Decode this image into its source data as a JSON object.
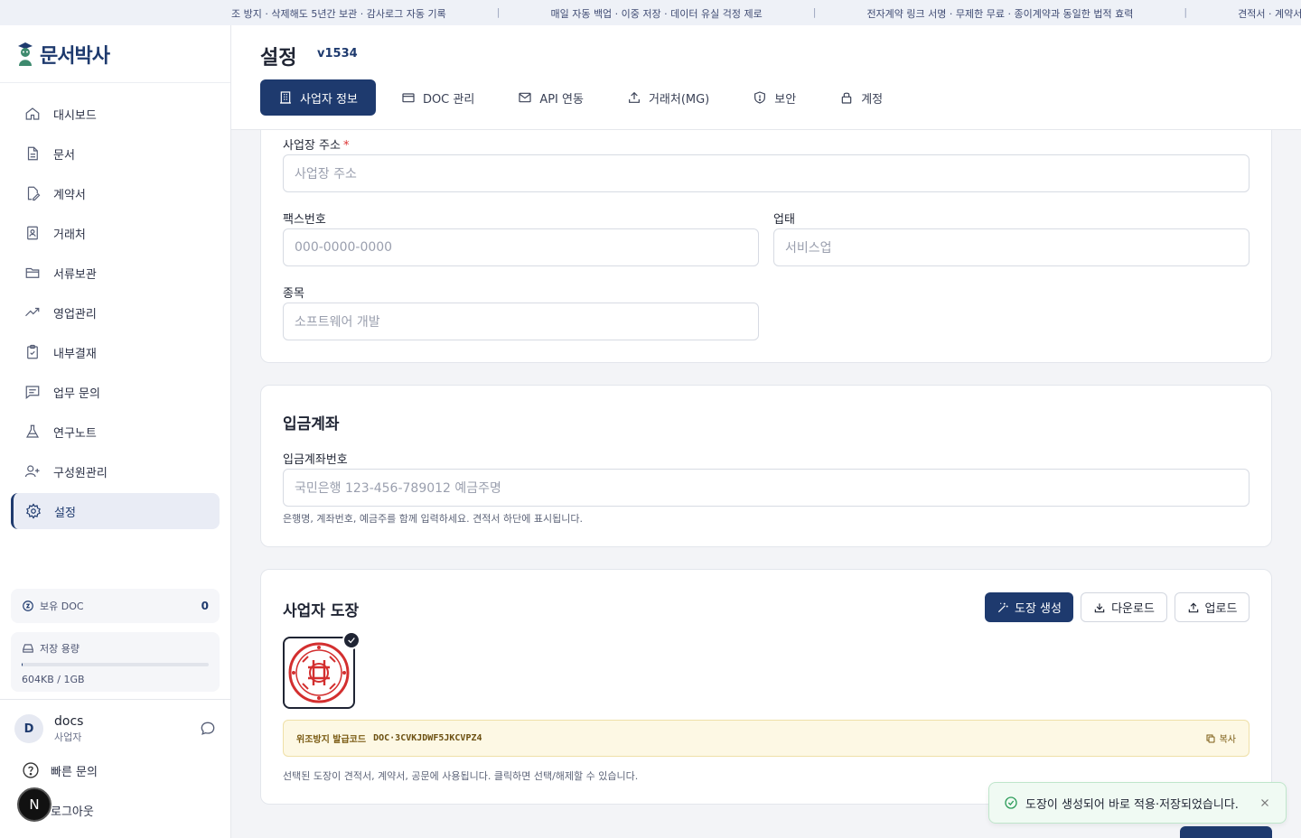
{
  "ticker": [
    "조 방지 · 삭제해도 5년간 보관 · 감사로그 자동 기록",
    "매일 자동 백업 · 이중 저장 · 데이터 유실 걱정 제로",
    "전자계약 링크 서명 · 무제한 무료 · 종이계약과 동일한 법적 효력",
    "견적서 · 계약서"
  ],
  "brand": {
    "name": "문서박사"
  },
  "sidebar": {
    "items": [
      {
        "label": "대시보드",
        "icon": "home-icon"
      },
      {
        "label": "문서",
        "icon": "document-icon"
      },
      {
        "label": "계약서",
        "icon": "contract-icon"
      },
      {
        "label": "거래처",
        "icon": "contact-icon"
      },
      {
        "label": "서류보관",
        "icon": "folder-icon"
      },
      {
        "label": "영업관리",
        "icon": "trend-icon"
      },
      {
        "label": "내부결재",
        "icon": "clipboard-check-icon"
      },
      {
        "label": "업무 문의",
        "icon": "message-icon"
      },
      {
        "label": "연구노트",
        "icon": "flask-icon"
      },
      {
        "label": "구성원관리",
        "icon": "user-plus-icon"
      },
      {
        "label": "설정",
        "icon": "gear-icon"
      }
    ],
    "doc_label": "보유 DOC",
    "doc_count": "0",
    "storage_label": "저장 용량",
    "storage_text": "604KB / 1GB",
    "storage_fraction": 0.0006,
    "user": {
      "initial": "D",
      "name": "docs",
      "role": "사업자"
    },
    "quick_inquiry": "빠른 문의",
    "logout": "로그아웃",
    "n_badge": "N"
  },
  "header": {
    "title": "설정",
    "version": "v1534",
    "tabs": [
      "사업자 정보",
      "DOC 관리",
      "API 연동",
      "거래처(MG)",
      "보안",
      "계정"
    ]
  },
  "business": {
    "address_label": "사업장 주소",
    "address_required": "*",
    "address_placeholder": "사업장 주소",
    "fax_label": "팩스번호",
    "fax_placeholder": "000-0000-0000",
    "biz_type_label": "업태",
    "biz_type_placeholder": "서비스업",
    "biz_item_label": "종목",
    "biz_item_placeholder": "소프트웨어 개발"
  },
  "bank": {
    "title": "입금계좌",
    "account_label": "입금계좌번호",
    "account_placeholder": "국민은행 123-456-789012 예금주명",
    "hint": "은행명, 계좌번호, 예금주를 함께 입력하세요. 견적서 하단에 표시됩니다."
  },
  "seal": {
    "title": "사업자 도장",
    "generate_label": "도장 생성",
    "download_label": "다운로드",
    "upload_label": "업로드",
    "code_label": "위조방지 발급코드",
    "code_value": "DOC·3CVKJDWF5JKCVPZ4",
    "copy_label": "복사",
    "hint": "선택된 도장이 견적서, 계약서, 공문에 사용됩니다. 클릭하면 선택/해제할 수 있습니다."
  },
  "toast": {
    "message": "도장이 생성되어 바로 적용·저장되었습니다."
  },
  "colors": {
    "primary": "#1e3a6e",
    "seal_red": "#d32f2f",
    "success": "#2e9d5b"
  }
}
